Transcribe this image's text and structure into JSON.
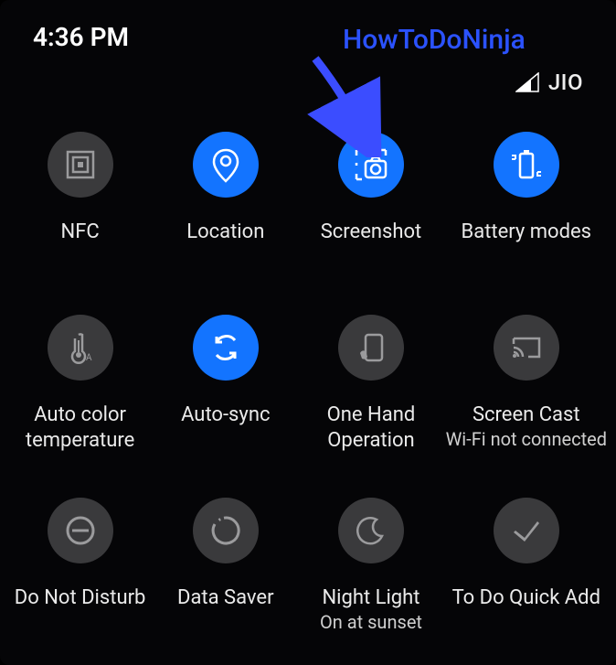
{
  "status": {
    "time": "4:36 PM",
    "carrier": "JIO"
  },
  "overlay": {
    "text": "HowToDoNinja"
  },
  "tiles": [
    {
      "id": "nfc",
      "label": "NFC",
      "sub": "",
      "active": false,
      "icon": "nfc"
    },
    {
      "id": "location",
      "label": "Location",
      "sub": "",
      "active": true,
      "icon": "location"
    },
    {
      "id": "screenshot",
      "label": "Screenshot",
      "sub": "",
      "active": true,
      "icon": "screenshot"
    },
    {
      "id": "battery-modes",
      "label": "Battery modes",
      "sub": "",
      "active": true,
      "icon": "battery"
    },
    {
      "id": "auto-color-temp",
      "label": "Auto color temperature",
      "sub": "",
      "active": false,
      "icon": "thermo"
    },
    {
      "id": "auto-sync",
      "label": "Auto-sync",
      "sub": "",
      "active": true,
      "icon": "sync"
    },
    {
      "id": "one-hand",
      "label": "One Hand Operation",
      "sub": "",
      "active": false,
      "icon": "onehand"
    },
    {
      "id": "screen-cast",
      "label": "Screen Cast",
      "sub": "Wi-Fi not connected",
      "active": false,
      "icon": "cast"
    },
    {
      "id": "dnd",
      "label": "Do Not Disturb",
      "sub": "",
      "active": false,
      "icon": "dnd"
    },
    {
      "id": "data-saver",
      "label": "Data Saver",
      "sub": "",
      "active": false,
      "icon": "datasaver"
    },
    {
      "id": "night-light",
      "label": "Night Light",
      "sub": "On at sunset",
      "active": false,
      "icon": "moon"
    },
    {
      "id": "todo",
      "label": "To Do Quick Add",
      "sub": "",
      "active": false,
      "icon": "check"
    }
  ]
}
